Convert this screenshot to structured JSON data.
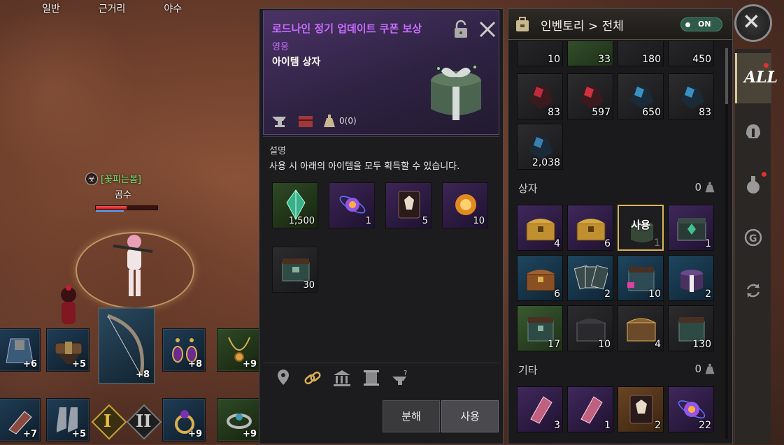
{
  "filter_tabs": [
    "일반",
    "근거리",
    "야수"
  ],
  "player": {
    "guild": "[꽃피는봄]",
    "name": "곰수",
    "hp_fraction": 0.5,
    "mp_fraction": 0.45
  },
  "equipment": {
    "top_row": [
      {
        "enh": "+6",
        "icon": "cloak-icon"
      },
      {
        "enh": "+5",
        "icon": "belt-icon"
      },
      {
        "enh": "+8",
        "icon": "earring-icon"
      },
      {
        "enh": "+9",
        "icon": "necklace-icon"
      }
    ],
    "weapon": {
      "enh": "+8",
      "icon": "bow-icon"
    },
    "bottom_row": [
      {
        "enh": "+7",
        "icon": "glove-icon"
      },
      {
        "enh": "+5",
        "icon": "boots-icon"
      },
      {
        "enh": "+9",
        "icon": "ring-icon"
      },
      {
        "enh": "+9",
        "icon": "ring-icon"
      }
    ],
    "preset_1": "I",
    "preset_2": "II"
  },
  "detail": {
    "title": "로드나인 정기 업데이트 쿠폰 보상",
    "grade": "영웅",
    "type": "아이템 상자",
    "weight": "0(0)",
    "desc_label": "설명",
    "desc_text": "사용 시 아래의 아이템을 모두 획득할 수 있습니다.",
    "rewards": [
      {
        "count": "1,500",
        "icon": "green-crystal-icon",
        "color": "green"
      },
      {
        "count": "1",
        "icon": "purple-orb-icon",
        "color": "purple"
      },
      {
        "count": "5",
        "icon": "dark-book-icon",
        "color": "purple"
      },
      {
        "count": "10",
        "icon": "orange-orb-icon",
        "color": "purple"
      },
      {
        "count": "30",
        "icon": "chest-icon",
        "color": "dark"
      }
    ],
    "btn_dismantle": "분해",
    "btn_use": "사용"
  },
  "inventory": {
    "title": "인벤토리 > 전체",
    "toggle": "ON",
    "top_partial": [
      "10",
      "33",
      "180",
      "450"
    ],
    "ores": [
      "83",
      "597",
      "650",
      "83"
    ],
    "ore_last": "2,038",
    "section_box": {
      "label": "상자",
      "weight": "0"
    },
    "boxes": [
      {
        "count": "4",
        "icon": "gold-chest-icon",
        "color": "purple"
      },
      {
        "count": "6",
        "icon": "gold-chest-icon",
        "color": "purple"
      },
      {
        "count": "1",
        "icon": "gift-box-icon",
        "selected": true,
        "overlay": "사용"
      },
      {
        "count": "1",
        "icon": "green-chest-icon",
        "color": "purple"
      },
      {
        "count": "6",
        "icon": "wood-chest-icon",
        "color": "blue"
      },
      {
        "count": "2",
        "icon": "card-pack-icon",
        "color": "blue"
      },
      {
        "count": "10",
        "icon": "chest-icon",
        "color": "blue"
      },
      {
        "count": "2",
        "icon": "gift-box-icon",
        "color": "blue"
      },
      {
        "count": "17",
        "icon": "chest-icon",
        "color": "green"
      },
      {
        "count": "10",
        "icon": "dark-chest-icon",
        "color": "dark"
      },
      {
        "count": "4",
        "icon": "brown-chest-icon",
        "color": "dark"
      },
      {
        "count": "130",
        "icon": "chest-icon",
        "color": "dark"
      }
    ],
    "section_etc": {
      "label": "기타",
      "weight": "0"
    },
    "etc": [
      {
        "count": "3",
        "icon": "pink-crystal-icon",
        "color": "purple"
      },
      {
        "count": "1",
        "icon": "pink-crystal-icon",
        "color": "purple"
      },
      {
        "count": "2",
        "icon": "dark-book-icon",
        "color": "purple"
      },
      {
        "count": "22",
        "icon": "purple-orb-icon",
        "color": "purple"
      }
    ]
  },
  "side_tabs": {
    "all": "ALL"
  }
}
